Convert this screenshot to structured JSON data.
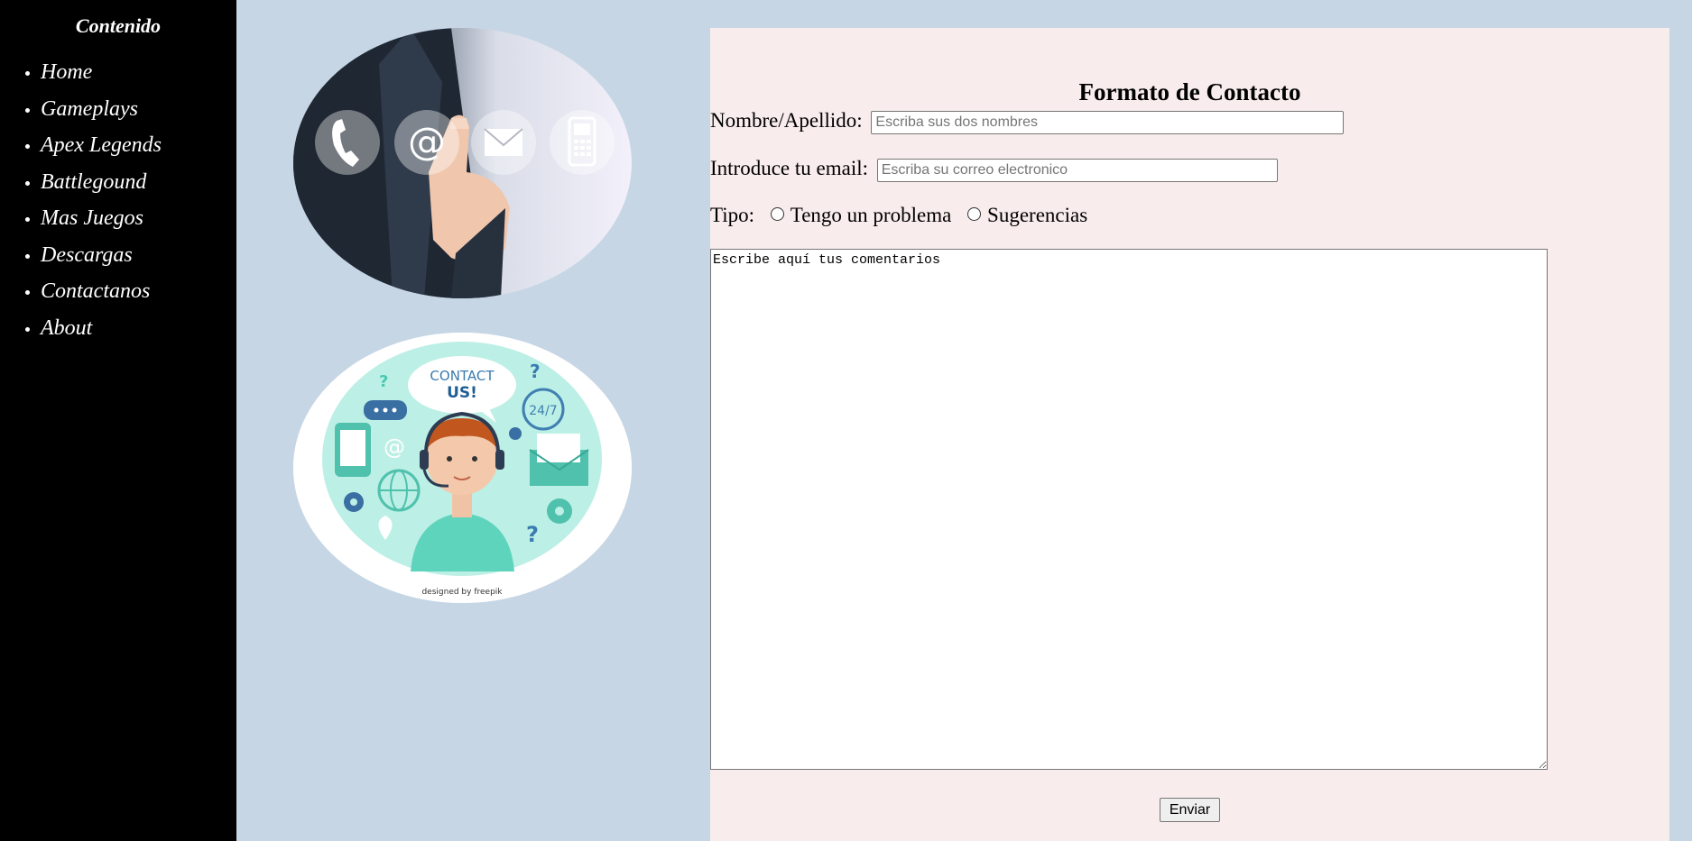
{
  "sidebar": {
    "title": "Contenido",
    "items": [
      {
        "label": "Home"
      },
      {
        "label": "Gameplays"
      },
      {
        "label": "Apex Legends"
      },
      {
        "label": "Battlegound"
      },
      {
        "label": "Mas Juegos"
      },
      {
        "label": "Descargas"
      },
      {
        "label": "Contactanos"
      },
      {
        "label": "About"
      }
    ]
  },
  "images": {
    "contact_us_text_1": "CONTACT",
    "contact_us_text_2": "US!",
    "badge_24_7": "24/7",
    "credit": "designed by freepik"
  },
  "form": {
    "title": "Formato de Contacto",
    "name_label": "Nombre/Apellido:",
    "name_placeholder": "Escriba sus dos nombres",
    "email_label": "Introduce tu email:",
    "email_placeholder": "Escriba su correo electronico",
    "tipo_label": "Tipo:",
    "option_problem": "Tengo un problema",
    "option_suggestions": "Sugerencias",
    "comments_value": "Escribe aquí tus comentarios",
    "submit_label": "Enviar"
  },
  "colors": {
    "background": "#c6d6e5",
    "sidebar": "#000000",
    "form_panel": "#f9ecec"
  }
}
